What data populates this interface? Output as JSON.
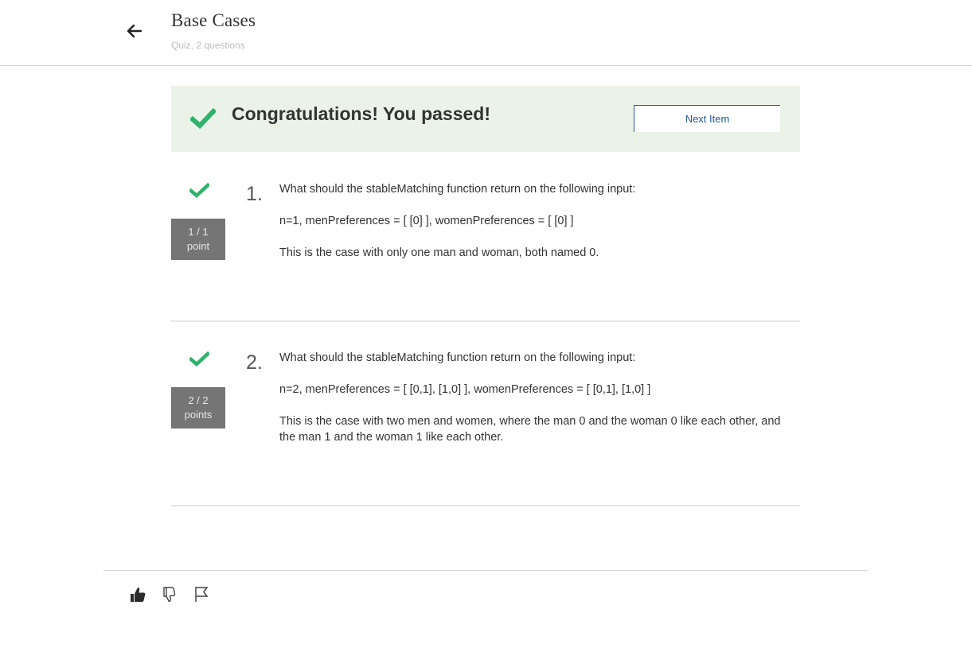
{
  "header": {
    "title": "Base Cases",
    "subtitle": "Quiz, 2 questions",
    "back_icon": "arrow-left-icon"
  },
  "banner": {
    "message": "Congratulations! You passed!",
    "next_label": "Next Item",
    "check_icon": "checkmark-icon",
    "colors": {
      "background": "#ebf3e9",
      "check": "#2fb26b",
      "link": "#1f5a96"
    }
  },
  "questions": [
    {
      "number": "1.",
      "score_line1": "1 / 1",
      "score_line2": "point",
      "prompt": "What should the stableMatching function return on the following input:",
      "input": "n=1, menPreferences = [ [0] ], womenPreferences = [ [0] ]",
      "note": "This is the case with only one man and woman, both named 0."
    },
    {
      "number": "2.",
      "score_line1": "2 / 2",
      "score_line2": "points",
      "prompt": "What should the stableMatching function return on the following input:",
      "input": "n=2, menPreferences = [ [0,1], [1,0] ], womenPreferences = [ [0,1], [1,0] ]",
      "note": "This is the case with two men and women, where the man 0 and the woman 0 like each other, and the man 1 and the woman 1 like each other."
    }
  ],
  "footer": {
    "icons": [
      "thumbs-up-icon",
      "thumbs-down-icon",
      "flag-icon"
    ]
  }
}
